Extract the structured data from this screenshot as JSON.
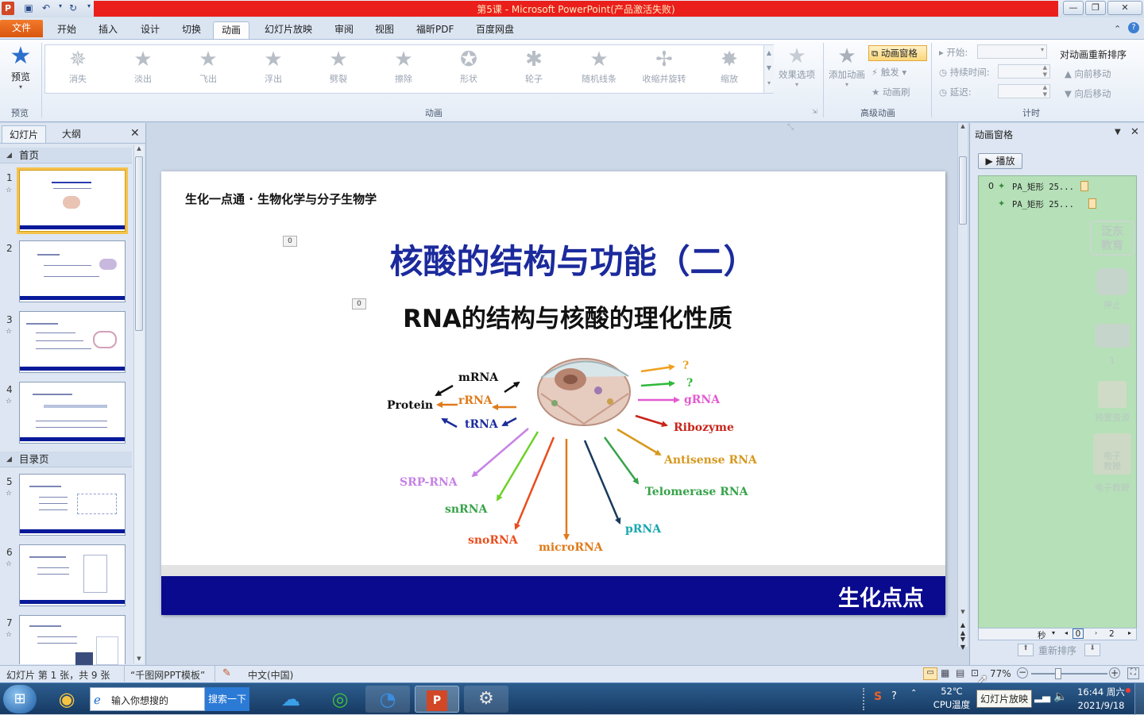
{
  "window": {
    "title": "第5课 - Microsoft PowerPoint(产品激活失败)",
    "buttons": {
      "minimize": "—",
      "restore": "❐",
      "close": "✕"
    }
  },
  "tabs": [
    {
      "label": "文件"
    },
    {
      "label": "开始"
    },
    {
      "label": "插入"
    },
    {
      "label": "设计"
    },
    {
      "label": "切换"
    },
    {
      "label": "动画"
    },
    {
      "label": "幻灯片放映"
    },
    {
      "label": "审阅"
    },
    {
      "label": "视图"
    },
    {
      "label": "福昕PDF"
    },
    {
      "label": "百度网盘"
    }
  ],
  "ribbon": {
    "preview": {
      "label": "预览",
      "group": "预览"
    },
    "animations": [
      "消失",
      "淡出",
      "飞出",
      "浮出",
      "劈裂",
      "擦除",
      "形状",
      "轮子",
      "随机线条",
      "收缩并旋转",
      "缩放"
    ],
    "animation_group": "动画",
    "effect_options": "效果选项",
    "add_animation": "添加动画",
    "animation_pane": "动画窗格",
    "trigger": "触发",
    "painter": "动画刷",
    "advanced_group": "高级动画",
    "start_label": "开始:",
    "duration_label": "持续时间:",
    "delay_label": "延迟:",
    "reorder_title": "对动画重新排序",
    "move_earlier": "向前移动",
    "move_later": "向后移动",
    "timing_group": "计时"
  },
  "left_pane": {
    "tab_slides": "幻灯片",
    "tab_outline": "大纲",
    "sections": [
      "首页",
      "目录页"
    ],
    "slides": [
      "1",
      "2",
      "3",
      "4",
      "5",
      "6",
      "7"
    ]
  },
  "slide": {
    "header": "生化一点通 · 生物化学与分子生物学",
    "title": "核酸的结构与功能（二）",
    "subtitle": "RNA的结构与核酸的理化性质",
    "badge1": "0",
    "badge2": "0",
    "footer": "生化点点",
    "diagram": {
      "protein": "Protein",
      "mrna": "mRNA",
      "rrna": "rRNA",
      "trna": "tRNA",
      "q1": "?",
      "q2": "?",
      "grna": "gRNA",
      "ribozyme": "Ribozyme",
      "antisense": "Antisense RNA",
      "telomerase": "Telomerase RNA",
      "prna": "pRNA",
      "microrna": "microRNA",
      "snorna": "snoRNA",
      "snrna": "snRNA",
      "srprna": "SRP-RNA"
    }
  },
  "animation_pane": {
    "title": "动画窗格",
    "play": "播放",
    "items": [
      {
        "index": "0",
        "name": "PA_矩形 25..."
      },
      {
        "index": "",
        "name": "PA_矩形 25..."
      }
    ],
    "watermark": [
      "泛东",
      "教育",
      "停止",
      "1",
      "预置资源",
      "电子",
      "教鞭",
      "电子教鞭"
    ],
    "seconds": "秒",
    "timeline_start": "0",
    "timeline_mark": "2",
    "reorder": "重新排序"
  },
  "status": {
    "slide_info": "幻灯片 第 1 张，共 9 张",
    "theme": "“千图网PPT模板”",
    "language": "中文(中国)",
    "zoom": "77%",
    "tooltip": "幻灯片放映"
  },
  "taskbar": {
    "search_placeholder": "输入你想搜的",
    "search_button": "搜索一下",
    "temp": "52℃",
    "cpu": "CPU温度",
    "time": "16:44 周六",
    "date": "2021/9/18"
  }
}
